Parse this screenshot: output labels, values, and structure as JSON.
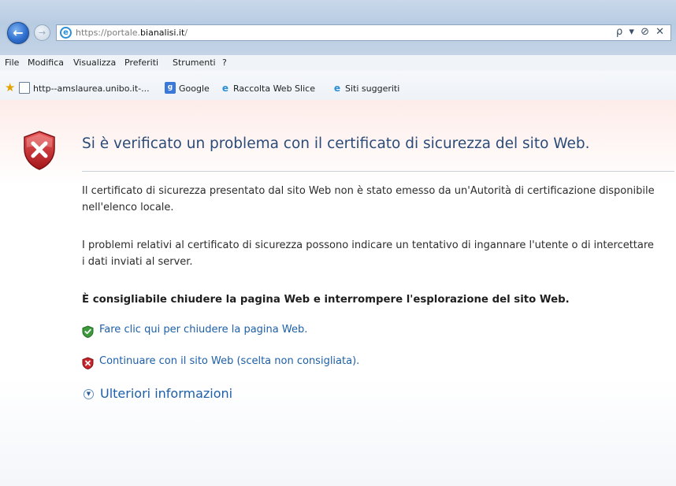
{
  "browser": {
    "url_protocol": "https://portale.",
    "url_domain": "bianalisi.it",
    "url_path": "/",
    "address_tools": "ρ ▾ ⊘ ✕"
  },
  "menu": [
    "File",
    "Modifica",
    "Visualizza",
    "Preferiti",
    "Strumenti",
    "?"
  ],
  "favorites": [
    {
      "icon": "page-icon",
      "label": "http--amslaurea.unibo.it-..."
    },
    {
      "icon": "google-icon",
      "label": "Google"
    },
    {
      "icon": "ie-icon",
      "label": "Raccolta Web Slice"
    },
    {
      "icon": "ie-icon",
      "label": "Siti suggeriti"
    }
  ],
  "page": {
    "title": "Si è verificato un problema con il certificato di sicurezza del sito Web.",
    "paragraph1": "Il certificato di sicurezza presentato dal sito Web non è stato emesso da un'Autorità di certificazione disponibile nell'elenco locale.",
    "paragraph2": "I problemi relativi al certificato di sicurezza possono indicare un tentativo di ingannare l'utente o di intercettare i dati inviati al server.",
    "recommendation": "È consigliabile chiudere la pagina Web e interrompere l'esplorazione del sito Web.",
    "close_link": "Fare clic qui per chiudere la pagina Web.",
    "continue_link": "Continuare con il sito Web (scelta non consigliata).",
    "more_info": "Ulteriori informazioni"
  },
  "colors": {
    "title": "#2b4b78",
    "link": "#1d5fa8",
    "shield_red": "#c8252c",
    "shield_green": "#3c9a3c"
  }
}
